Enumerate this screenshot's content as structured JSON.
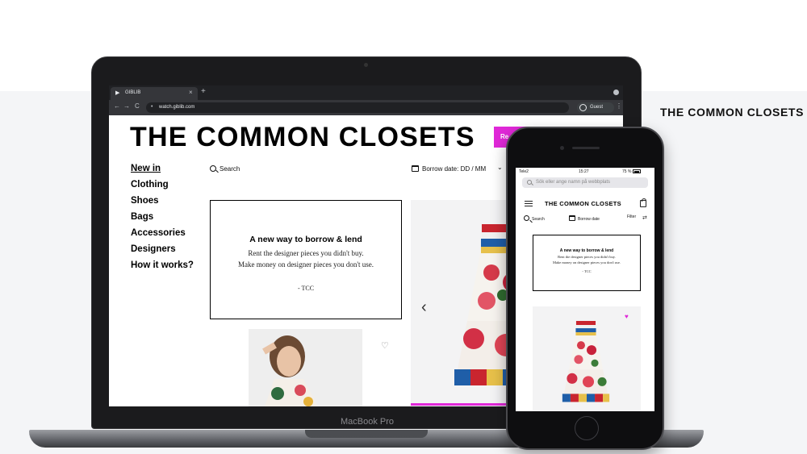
{
  "page": {
    "brand_caption": "THE COMMON CLOSETS"
  },
  "laptop": {
    "model_label": "MacBook Pro"
  },
  "browser": {
    "tab_title": "GIBLIB",
    "tab_close": "×",
    "new_tab": "+",
    "url": "watch.giblib.com",
    "profile_label": "Guest",
    "back": "←",
    "forward": "→",
    "reload": "C",
    "menu": "⋮",
    "lock": "🔒"
  },
  "desktop_site": {
    "title": "THE COMMON CLOSETS",
    "cta_partial": "Re",
    "nav": [
      "New in",
      "Clothing",
      "Shoes",
      "Bags",
      "Accessories",
      "Designers",
      "How it works?"
    ],
    "search_label": "Search",
    "borrow_label": "Borrow date: DD / MM",
    "promo": {
      "title": "A new way to borrow & lend",
      "line1": "Rent the designer pieces you didn't buy.",
      "line2": "Make money on designer pieces you don't use.",
      "signature": "- TCC"
    },
    "carousel_prev": "‹",
    "heart_icon": "heart-outline-icon"
  },
  "mobile_site": {
    "carrier": "Tele2",
    "time": "15:27",
    "battery": "75 %",
    "url_placeholder": "Sök eller ange namn på webbplats",
    "title": "THE COMMON CLOSETS",
    "search_label": "Search",
    "borrow_label": "Borrow date",
    "filter_label": "Filter",
    "promo": {
      "title": "A new way to borrow & lend",
      "line1": "Rent the designer pieces you didn't buy.",
      "line2": "Make money on designer pieces you don't use.",
      "signature": "- TCC"
    },
    "heart_icon": "heart-filled-icon"
  },
  "colors": {
    "accent": "#e028d8",
    "text": "#000000",
    "background": "#f4f5f7"
  }
}
